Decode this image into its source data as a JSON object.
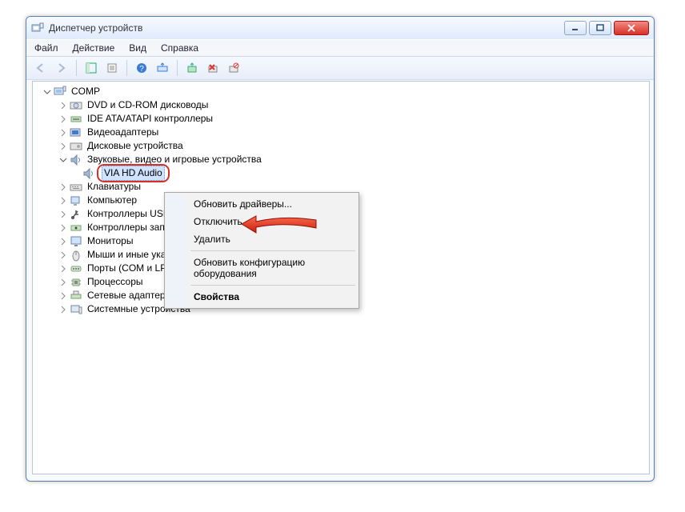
{
  "window": {
    "title": "Диспетчер устройств"
  },
  "menu": {
    "file": "Файл",
    "action": "Действие",
    "view": "Вид",
    "help": "Справка"
  },
  "tree": {
    "root": "COMP",
    "dvd": "DVD и CD-ROM дисководы",
    "ide": "IDE ATA/ATAPI контроллеры",
    "video": "Видеоадаптеры",
    "disk": "Дисковые устройства",
    "sound_group": "Звуковые, видео и игровые устройства",
    "via_hd": "VIA HD Audio",
    "keyboards": "Клавиатуры",
    "computer": "Компьютер",
    "usb": "Контроллеры USB",
    "storage_ctrl": "Контроллеры запоминающих устройств",
    "monitors": "Мониторы",
    "mice": "Мыши и иные указывающие устройства",
    "ports": "Порты (COM и LPT)",
    "cpu": "Процессоры",
    "net": "Сетевые адаптеры",
    "system": "Системные устройства"
  },
  "context": {
    "update": "Обновить драйверы...",
    "disable": "Отключить",
    "delete": "Удалить",
    "refresh_hw": "Обновить конфигурацию оборудования",
    "properties": "Свойства"
  }
}
